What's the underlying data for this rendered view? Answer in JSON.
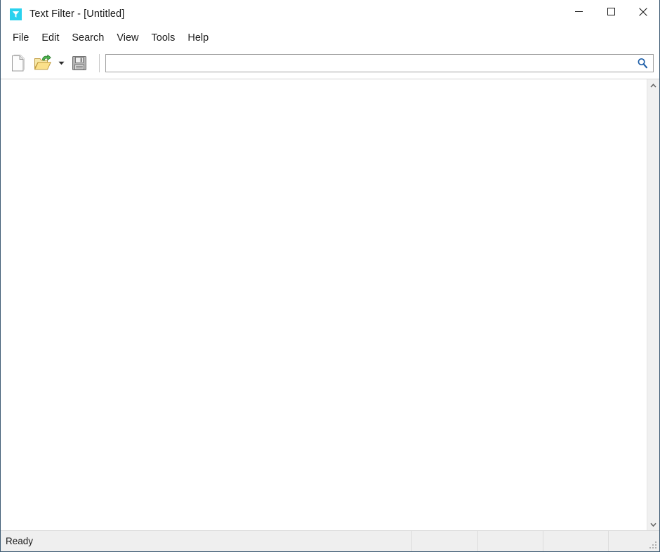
{
  "window": {
    "title": "Text Filter - [Untitled]",
    "app_icon": "filter-funnel-icon",
    "accent_color": "#2ad2ee",
    "frame_border_color": "#3d5a73"
  },
  "window_controls": {
    "minimize": "minimize-icon",
    "maximize": "maximize-icon",
    "close": "close-icon"
  },
  "menubar": {
    "items": [
      {
        "label": "File"
      },
      {
        "label": "Edit"
      },
      {
        "label": "Search"
      },
      {
        "label": "View"
      },
      {
        "label": "Tools"
      },
      {
        "label": "Help"
      }
    ]
  },
  "toolbar": {
    "new_icon": "new-document-icon",
    "open_icon": "open-folder-icon",
    "open_dropdown_icon": "chevron-down-icon",
    "save_icon": "save-floppy-icon",
    "search": {
      "value": "",
      "placeholder": "",
      "icon": "search-magnifier-icon",
      "icon_color": "#1f5fa8"
    }
  },
  "content": {
    "text": "",
    "scrollbar": {
      "up_icon": "chevron-up-icon",
      "down_icon": "chevron-down-icon"
    }
  },
  "statusbar": {
    "panes": [
      {
        "text": "Ready"
      },
      {
        "text": ""
      },
      {
        "text": ""
      },
      {
        "text": ""
      },
      {
        "text": ""
      }
    ],
    "resize_grip": "resize-grip-icon"
  }
}
